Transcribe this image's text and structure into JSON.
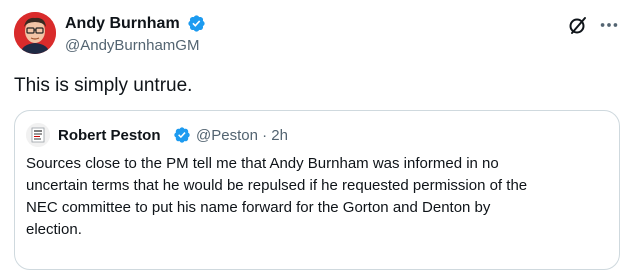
{
  "tweet": {
    "author": {
      "name": "Andy Burnham",
      "handle": "@AndyBurnhamGM",
      "avatar_icon": "andy-burnham-avatar",
      "verified_color": "#1d9bf0"
    },
    "text": "This is simply untrue.",
    "actions": {
      "grok_icon": "grok-icon",
      "more_icon": "more-icon"
    }
  },
  "quote": {
    "author": {
      "name": "Robert Peston",
      "handle": "@Peston",
      "separator": "·",
      "time": "2h",
      "avatar_icon": "robert-peston-avatar"
    },
    "text_lines": [
      "Sources close to the PM tell me that Andy Burnham was informed in no",
      "uncertain terms that he would be repulsed if he requested permission of the",
      "NEC committee to put his name forward for the Gorton and Denton by",
      "election."
    ]
  },
  "colors": {
    "primary_text": "#0f1419",
    "secondary_text": "#536471",
    "border": "#cfd9de",
    "verified": "#1d9bf0"
  }
}
